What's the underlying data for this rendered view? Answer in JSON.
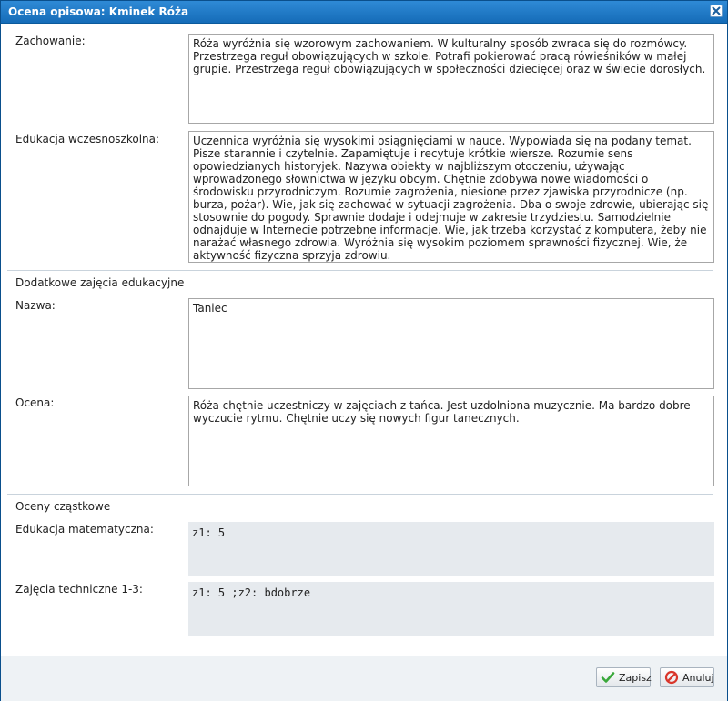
{
  "window": {
    "title": "Ocena opisowa: Kminek Róża"
  },
  "fields": {
    "zachowanie": {
      "label": "Zachowanie:",
      "value": "Róża wyróżnia się wzorowym zachowaniem. W kulturalny sposób zwraca się do rozmówcy. Przestrzega reguł obowiązujących w szkole. Potrafi pokierować pracą rówieśników w małej grupie. Przestrzega reguł obowiązujących w społeczności dziecięcej oraz w świecie dorosłych."
    },
    "edukacja": {
      "label": "Edukacja wczesnoszkolna:",
      "value": "Uczennica wyróżnia się wysokimi osiągnięciami w nauce. Wypowiada się na podany temat. Pisze starannie i czytelnie. Zapamiętuje i recytuje krótkie wiersze. Rozumie sens opowiedzianych historyjek. Nazywa obiekty w najbliższym otoczeniu, używając wprowadzonego słownictwa w języku obcym. Chętnie zdobywa nowe wiadomości o środowisku przyrodniczym. Rozumie zagrożenia, niesione przez zjawiska przyrodnicze (np. burza, pożar). Wie, jak się zachować w sytuacji zagrożenia. Dba o swoje zdrowie, ubierając się stosownie do pogody. Sprawnie dodaje i odejmuje w zakresie trzydziestu. Samodzielnie odnajduje w Internecie potrzebne informacje. Wie, jak trzeba korzystać z komputera, żeby nie narażać własnego zdrowia. Wyróżnia się wysokim poziomem sprawności fizycznej. Wie, że aktywność fizyczna sprzyja zdrowiu."
    }
  },
  "dodatkowe": {
    "section_label": "Dodatkowe zajęcia edukacyjne",
    "nazwa": {
      "label": "Nazwa:",
      "value": "Taniec"
    },
    "ocena": {
      "label": "Ocena:",
      "value": "Róża chętnie uczestniczy w zajęciach z tańca. Jest uzdolniona muzycznie. Ma bardzo dobre wyczucie rytmu. Chętnie uczy się nowych figur tanecznych."
    }
  },
  "cząstkowe": {
    "section_label": "Oceny cząstkowe",
    "items": [
      {
        "label": "Edukacja matematyczna:",
        "value": "z1: 5"
      },
      {
        "label": "Zajęcia techniczne 1-3:",
        "value": "z1: 5 ;z2: bdobrze"
      }
    ]
  },
  "buttons": {
    "save": "Zapisz",
    "cancel": "Anuluj"
  },
  "colors": {
    "titlebar": "#1a75c4",
    "save_icon": "#3aa83a",
    "cancel_icon": "#d9362b"
  }
}
